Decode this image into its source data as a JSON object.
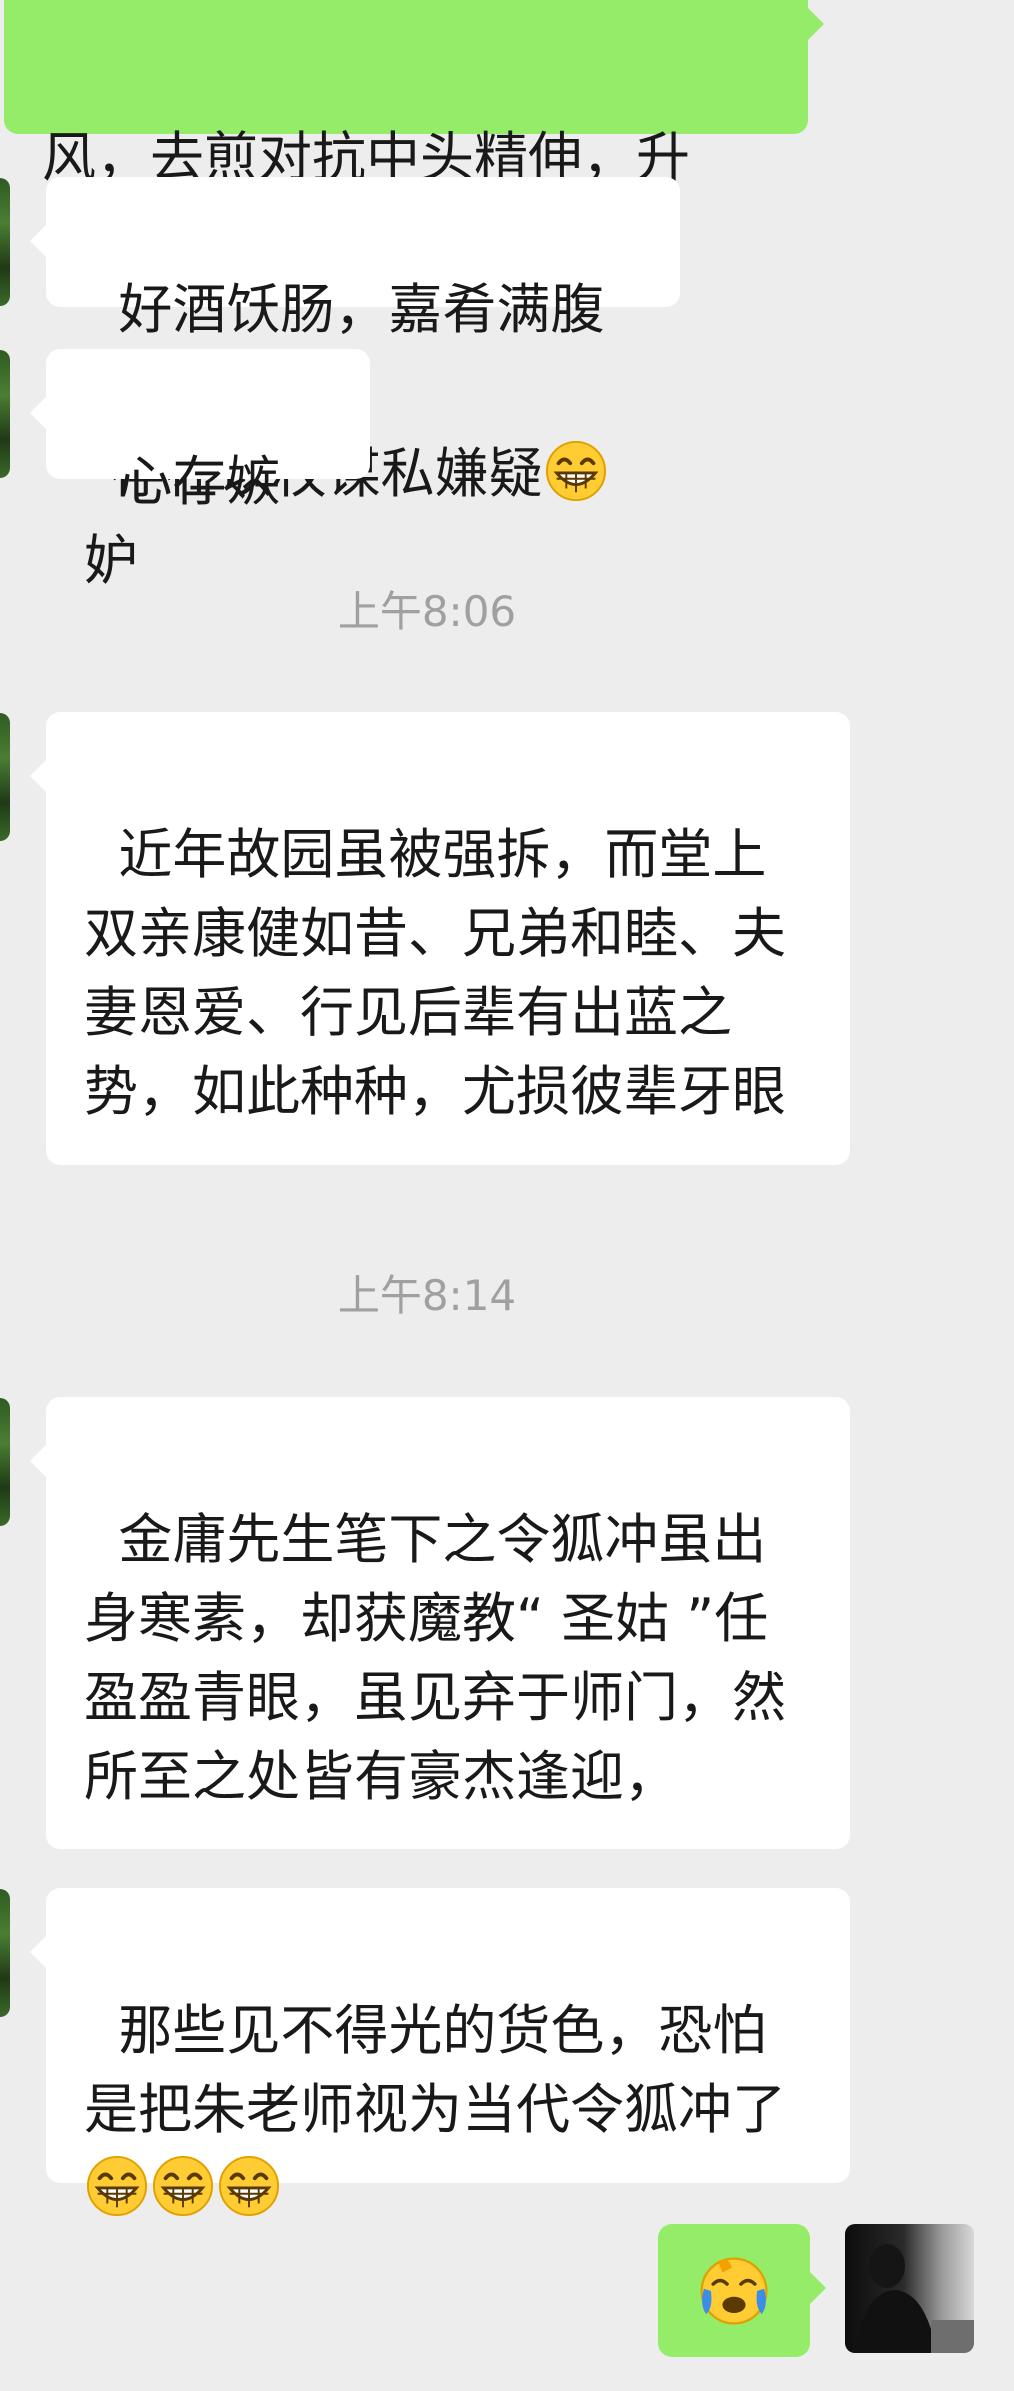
{
  "messages": {
    "top_outgoing": {
      "line1": "风，去煎对抗中头精伸，升",
      "line2": "存在以权谋私嫌疑"
    },
    "m1": "好酒饫肠，嘉肴满腹",
    "m2": "心存嫉妒",
    "time1": "上午8:06",
    "m3": "近年故园虽被强拆，而堂上双亲康健如昔、兄弟和睦、夫妻恩爱、行见后辈有出蓝之势，如此种种，尤损彼辈牙眼",
    "time2": "上午8:14",
    "m4": "金庸先生笔下之令狐冲虽出身寒素，却获魔教“ 圣姑 ”任盈盈青眼，虽见弃于师门，然所至之处皆有豪杰逢迎，",
    "m5": "那些见不得光的货色，恐怕是把朱老师视为当代令狐冲了"
  },
  "icons": {
    "grin": "grinning-face-emoji",
    "cry": "loudly-crying-face-emoji"
  },
  "colors": {
    "background": "#ededed",
    "incoming_bubble": "#ffffff",
    "outgoing_bubble": "#95ec69",
    "timestamp": "#a0a0a0"
  }
}
